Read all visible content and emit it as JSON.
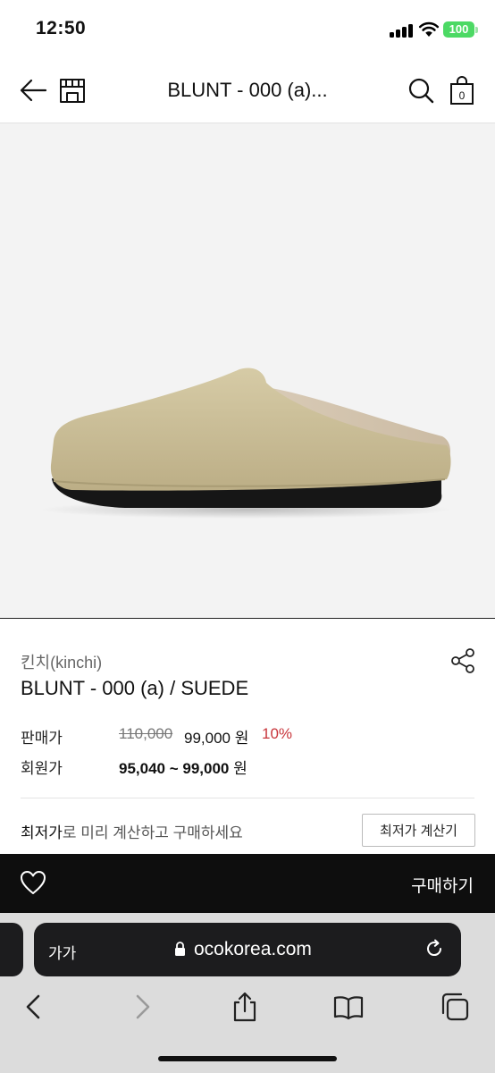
{
  "status_bar": {
    "time": "12:50",
    "battery": "100",
    "icons": [
      "signal-icon",
      "wifi-icon",
      "battery-icon"
    ]
  },
  "header": {
    "title": "BLUNT - 000 (a)...",
    "icons": [
      "back-arrow-icon",
      "store-icon",
      "search-icon",
      "shopping-bag-icon"
    ],
    "cart_count": "0"
  },
  "product": {
    "brand": "킨치(kinchi)",
    "name": "BLUNT - 000 (a) / SUEDE",
    "image": "beige suede mule clog with black sole",
    "sale_label": "판매가",
    "original_price": "110,000",
    "sale_price": "99,000 원",
    "discount": "10%",
    "member_label": "회원가",
    "member_price": "95,040 ~ 99,000",
    "member_unit": " 원",
    "calc_highlight": "최저가",
    "calc_text": "로 미리 계산하고 구매하세요",
    "calc_button": "최저가 계산기"
  },
  "purchase_bar": {
    "buy_label": "구매하기",
    "icon": "heart-icon"
  },
  "browser": {
    "text_size_label": "가가",
    "url": "ocokorea.com",
    "icons": [
      "lock-icon",
      "reload-icon",
      "back-icon",
      "forward-icon",
      "share-icon",
      "bookmarks-icon",
      "tabs-icon"
    ]
  },
  "colors": {
    "discount": "#c8353b",
    "purchase_bar_bg": "#0e0e0e",
    "battery": "#4cd964",
    "image_bg": "#f3f3f3",
    "shoe_suede": "#c9bd97"
  }
}
